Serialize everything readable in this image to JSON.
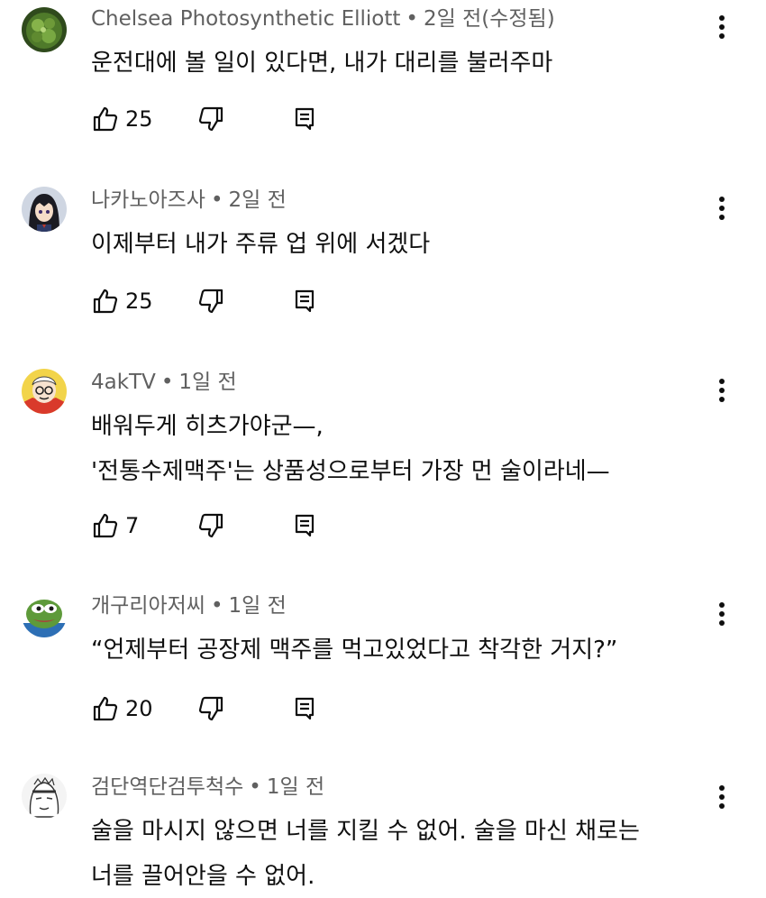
{
  "comments": [
    {
      "author": "Chelsea Photosynthetic Elliott",
      "time": "2일 전(수정됨)",
      "lines": [
        "운전대에 볼 일이 있다면, 내가 대리를 불러주마"
      ],
      "likes": "25",
      "avatar_icon": "green-ball-avatar"
    },
    {
      "author": "나카노아즈사",
      "time": "2일 전",
      "lines": [
        "이제부터 내가 주류 업 위에 서겠다"
      ],
      "likes": "25",
      "avatar_icon": "anime-girl-avatar"
    },
    {
      "author": "4akTV",
      "time": "1일 전",
      "lines": [
        "배워두게 히츠가야군—,",
        "'전통수제맥주'는 상품성으로부터 가장 먼 술이라네—"
      ],
      "likes": "7",
      "avatar_icon": "cartoon-face-avatar"
    },
    {
      "author": "개구리아저씨",
      "time": "1일 전",
      "lines": [
        "“언제부터 공장제 맥주를 먹고있었다고 착각한 거지?”"
      ],
      "likes": "20",
      "avatar_icon": "pepe-frog-avatar"
    },
    {
      "author": "검단역단검투척수",
      "time": "1일 전",
      "lines": [
        "술을 마시지 않으면 너를 지킬 수 없어. 술을 마신 채로는",
        "너를 끌어안을 수 없어."
      ],
      "likes": "",
      "avatar_icon": "manga-sketch-avatar"
    }
  ],
  "meta_separator": "•",
  "colors": {
    "meta_text": "#606060",
    "body_text": "#0f0f0f",
    "icon": "#0f0f0f"
  }
}
